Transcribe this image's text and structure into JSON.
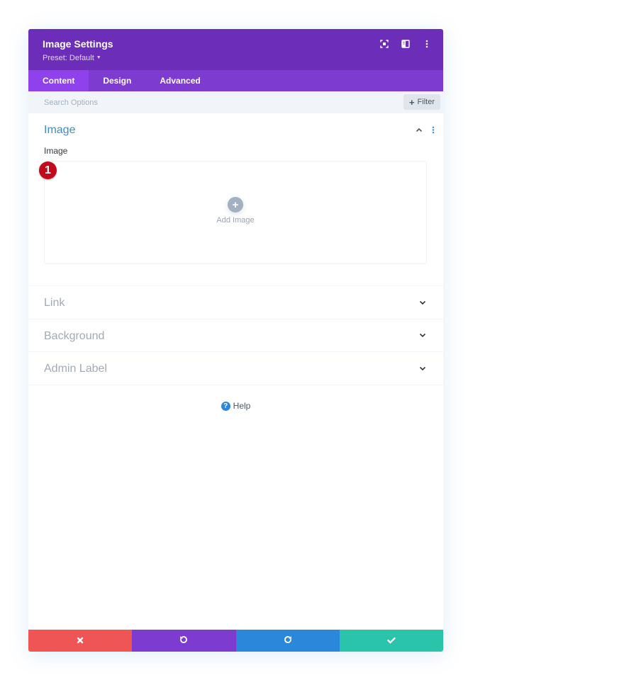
{
  "header": {
    "title": "Image Settings",
    "preset_label": "Preset: Default",
    "icons": [
      "screenshot-icon",
      "split-view-icon",
      "more-vertical-icon"
    ]
  },
  "tabs": [
    {
      "label": "Content",
      "active": true
    },
    {
      "label": "Design",
      "active": false
    },
    {
      "label": "Advanced",
      "active": false
    }
  ],
  "search": {
    "placeholder": "Search Options",
    "value": "",
    "filter_label": "Filter"
  },
  "sections": {
    "image": {
      "title": "Image",
      "expanded": true,
      "field_label": "Image",
      "badge": "1",
      "add_label": "Add Image"
    },
    "collapsed": [
      {
        "label": "Link"
      },
      {
        "label": "Background"
      },
      {
        "label": "Admin Label"
      }
    ]
  },
  "help": {
    "label": "Help"
  },
  "footer": {
    "buttons": [
      {
        "name": "discard",
        "icon": "close-icon",
        "color": "#ef5555"
      },
      {
        "name": "undo",
        "icon": "undo-icon",
        "color": "#7e3bd0"
      },
      {
        "name": "redo",
        "icon": "redo-icon",
        "color": "#2b87da"
      },
      {
        "name": "save",
        "icon": "check-icon",
        "color": "#29c4a9"
      }
    ]
  },
  "colors": {
    "header_bg": "#6c2eb9",
    "tabs_bg": "#7e3bd0",
    "active_tab_bg": "#8f42ec",
    "section_title": "#3e8dc7",
    "badge": "#c20a1c"
  }
}
